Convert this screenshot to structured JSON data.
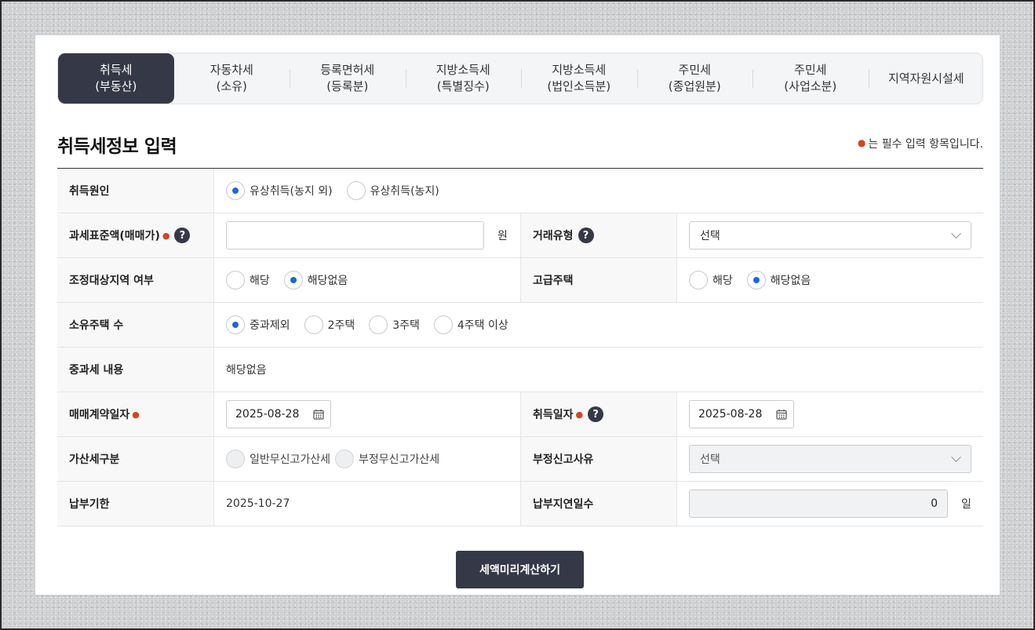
{
  "tabs": [
    {
      "label": "취득세\n(부동산)",
      "active": true
    },
    {
      "label": "자동차세\n(소유)"
    },
    {
      "label": "등록면허세\n(등록분)"
    },
    {
      "label": "지방소득세\n(특별징수)"
    },
    {
      "label": "지방소득세\n(법인소득분)"
    },
    {
      "label": "주민세\n(종업원분)"
    },
    {
      "label": "주민세\n(사업소분)"
    },
    {
      "label": "지역자원시설세"
    }
  ],
  "heading": {
    "title": "취득세정보 입력",
    "required_note": "는 필수 입력 항목입니다."
  },
  "form": {
    "acq_reason": {
      "label": "취득원인",
      "options": [
        "유상취득(농지 외)",
        "유상취득(농지)"
      ],
      "selected": "유상취득(농지 외)"
    },
    "tax_base": {
      "label": "과세표준액(매매가)",
      "value": "",
      "unit": "원"
    },
    "deal_type": {
      "label": "거래유형",
      "value": "선택"
    },
    "adjust_area": {
      "label": "조정대상지역 여부",
      "options": [
        "해당",
        "해당없음"
      ],
      "selected": "해당없음"
    },
    "luxury_house": {
      "label": "고급주택",
      "options": [
        "해당",
        "해당없음"
      ],
      "selected": "해당없음"
    },
    "house_count": {
      "label": "소유주택 수",
      "options": [
        "중과제외",
        "2주택",
        "3주택",
        "4주택 이상"
      ],
      "selected": "중과제외"
    },
    "heavy_tax": {
      "label": "중과세 내용",
      "value": "해당없음"
    },
    "contract_date": {
      "label": "매매계약일자",
      "value": "2025-08-28"
    },
    "acq_date": {
      "label": "취득일자",
      "value": "2025-08-28"
    },
    "penalty_type": {
      "label": "가산세구분",
      "options": [
        "일반무신고가산세",
        "부정무신고가산세"
      ]
    },
    "fraud_reason": {
      "label": "부정신고사유",
      "value": "선택"
    },
    "due_date": {
      "label": "납부기한",
      "value": "2025-10-27"
    },
    "delay_days": {
      "label": "납부지연일수",
      "value": "0",
      "unit": "일"
    }
  },
  "calc_button": "세액미리계산하기",
  "colors": {
    "accent": "#1a67e0",
    "dark": "#353846",
    "required": "#d9431e"
  }
}
